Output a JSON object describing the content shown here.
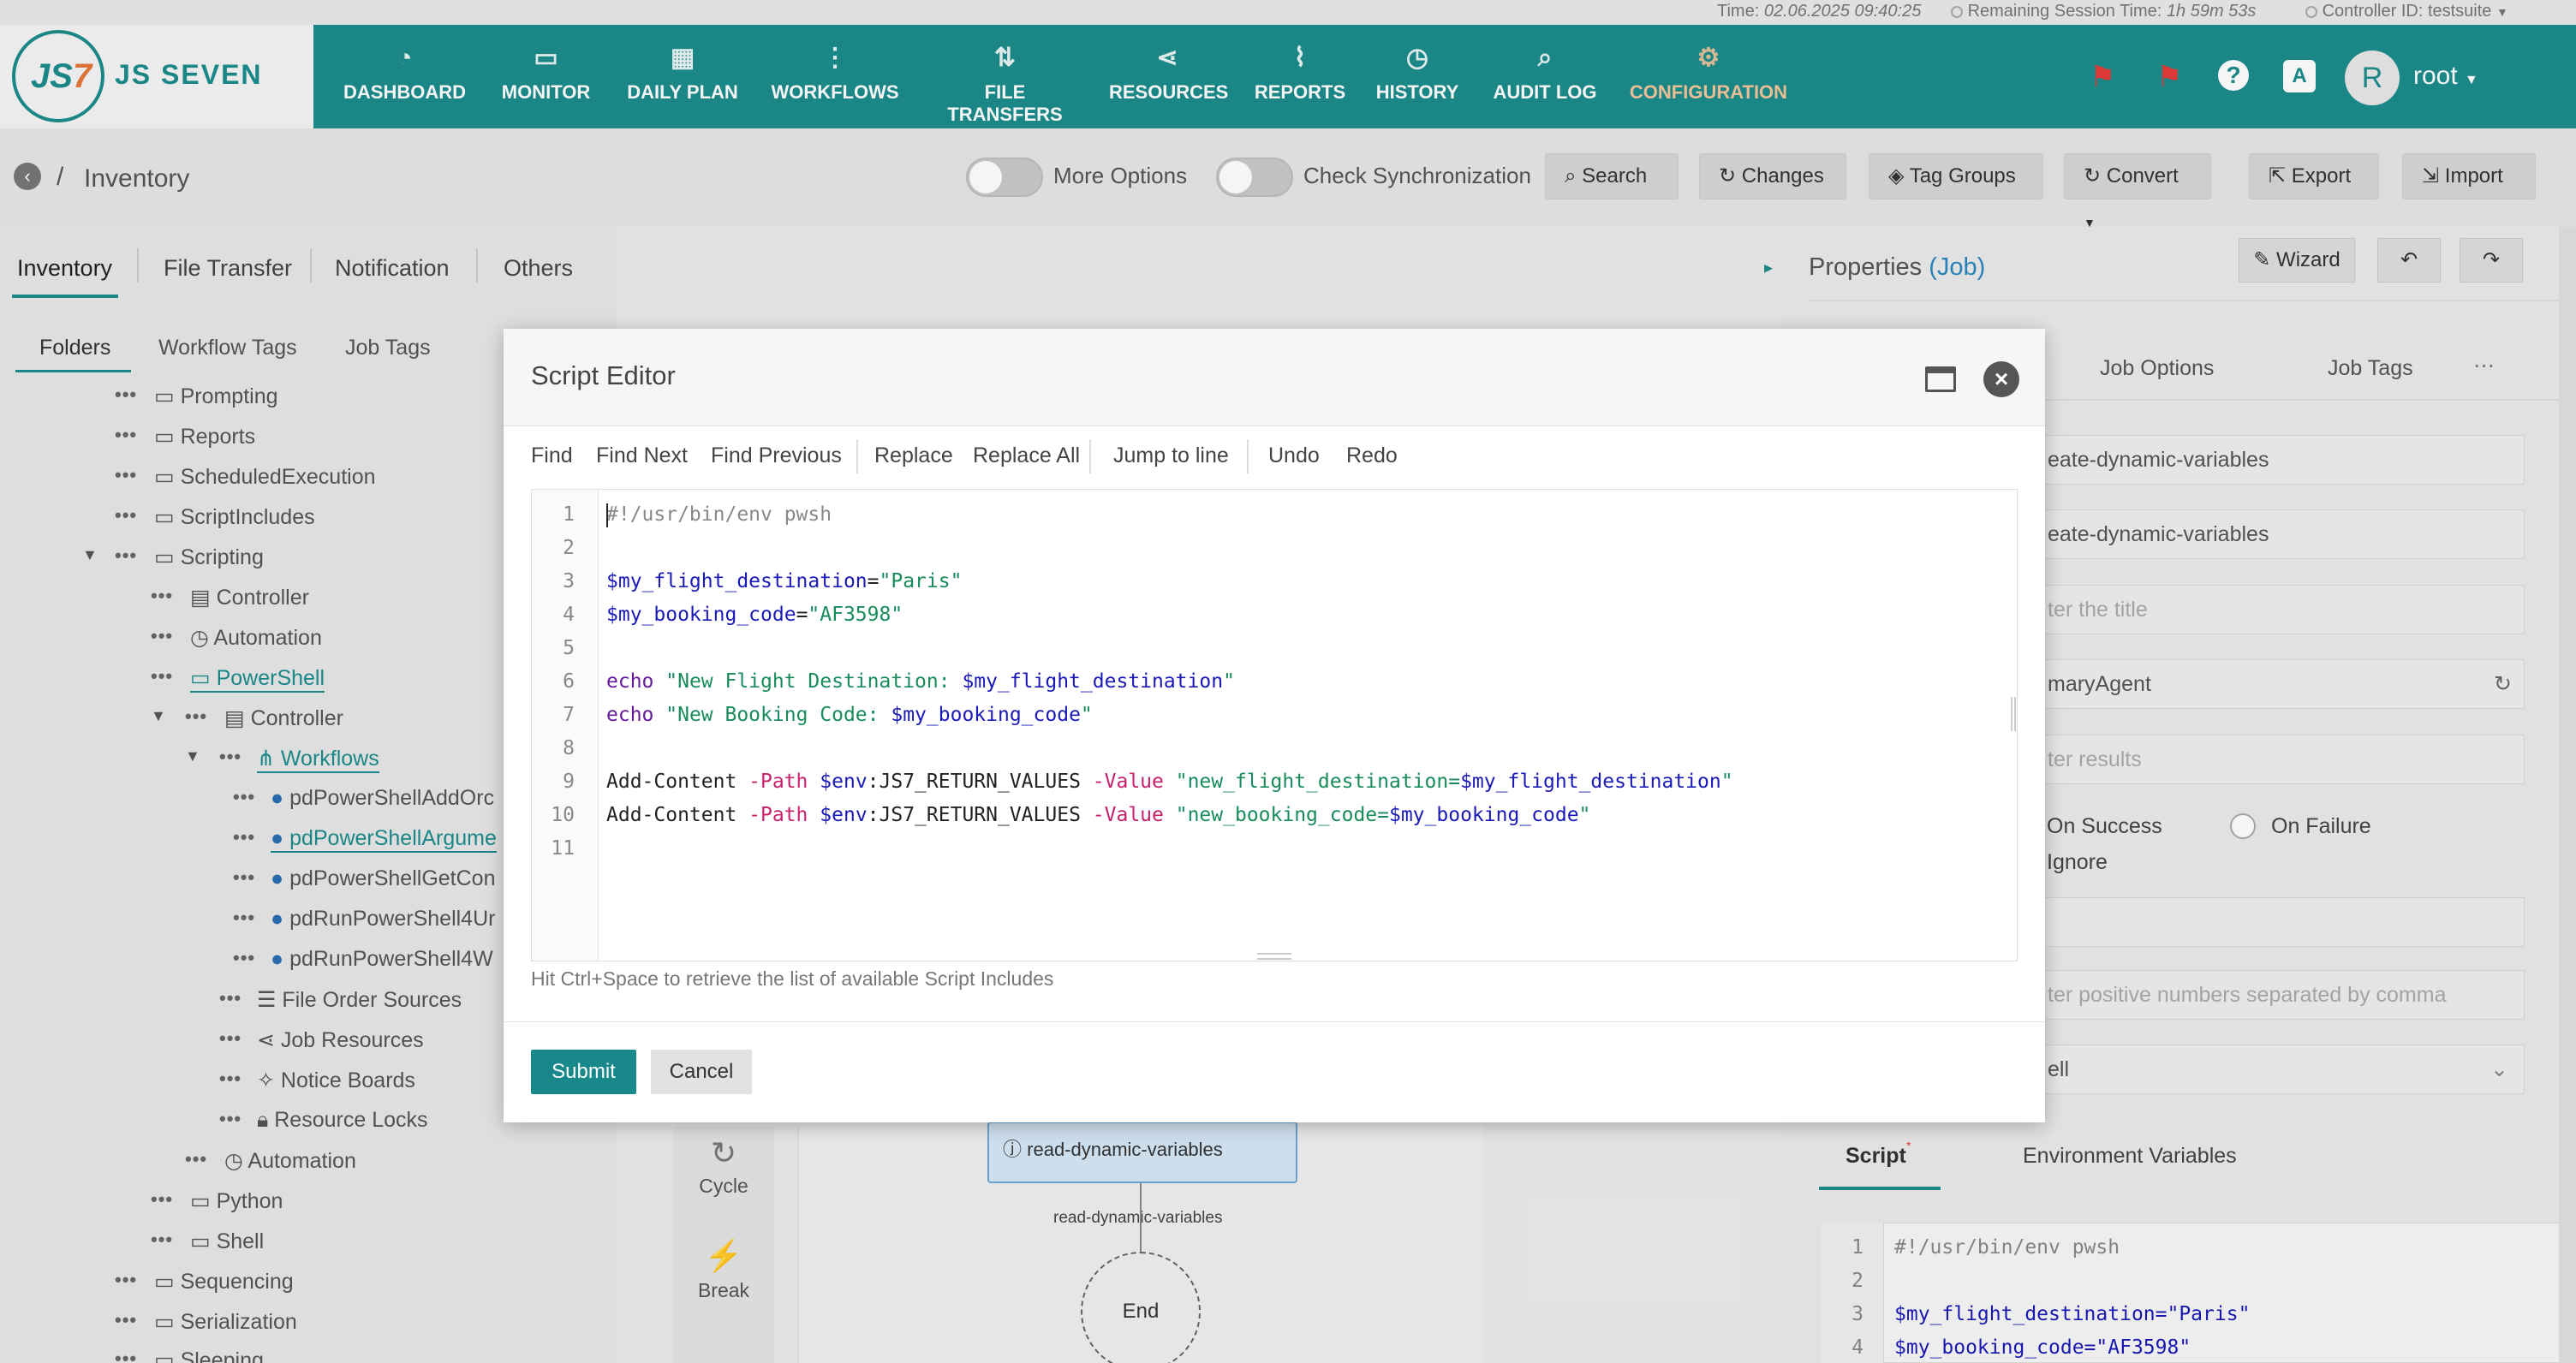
{
  "topbar": {
    "time_label": "Time:",
    "time_value": "02.06.2025 09:40:25",
    "remaining_label": "Remaining Session Time:",
    "remaining_value": "1h 59m 53s",
    "controller_label": "Controller ID:",
    "controller_value": "testsuite"
  },
  "brand": {
    "logo_text": "JS SEVEN",
    "logo_mark": "JS7"
  },
  "nav": {
    "items": [
      {
        "label": "DASHBOARD",
        "icon": "dashboard-icon",
        "glyph": "◔"
      },
      {
        "label": "MONITOR",
        "icon": "monitor-icon",
        "glyph": "▭"
      },
      {
        "label": "DAILY PLAN",
        "icon": "calendar-icon",
        "glyph": "▦"
      },
      {
        "label": "WORKFLOWS",
        "icon": "workflow-icon",
        "glyph": "⋮"
      },
      {
        "label": "FILE TRANSFERS",
        "icon": "transfer-icon",
        "glyph": "⇅"
      },
      {
        "label": "RESOURCES",
        "icon": "share-icon",
        "glyph": "⋖"
      },
      {
        "label": "REPORTS",
        "icon": "chart-icon",
        "glyph": "⌇"
      },
      {
        "label": "HISTORY",
        "icon": "clock-icon",
        "glyph": "◷"
      },
      {
        "label": "AUDIT LOG",
        "icon": "audit-icon",
        "glyph": "⌕"
      },
      {
        "label": "CONFIGURATION",
        "icon": "gear-icon",
        "glyph": "⚙"
      }
    ],
    "user_initial": "R",
    "user_name": "root"
  },
  "breadcrumb": {
    "separator": "/",
    "title": "Inventory"
  },
  "toolbar": {
    "more_options": "More Options",
    "check_sync": "Check Synchronization",
    "search": "Search",
    "changes": "Changes",
    "tag_groups": "Tag Groups",
    "convert": "Convert",
    "export": "Export",
    "import": "Import"
  },
  "left_tabs": {
    "inventory": "Inventory",
    "file_transfer": "File Transfer",
    "notification": "Notification",
    "others": "Others"
  },
  "sub_tabs": {
    "folders": "Folders",
    "workflow_tags": "Workflow Tags",
    "job_tags": "Job Tags"
  },
  "tree": [
    {
      "label": "Prompting"
    },
    {
      "label": "Reports"
    },
    {
      "label": "ScheduledExecution"
    },
    {
      "label": "ScriptIncludes"
    },
    {
      "label": "Scripting"
    },
    {
      "label": "Controller"
    },
    {
      "label": "Automation"
    },
    {
      "label": "PowerShell"
    },
    {
      "label": "Controller"
    },
    {
      "label": "Workflows"
    },
    {
      "label": "pdPowerShellAddOrc"
    },
    {
      "label": "pdPowerShellArgume"
    },
    {
      "label": "pdPowerShellGetCon"
    },
    {
      "label": "pdRunPowerShell4Ur"
    },
    {
      "label": "pdRunPowerShell4W"
    },
    {
      "label": "File Order Sources"
    },
    {
      "label": "Job Resources"
    },
    {
      "label": "Notice Boards"
    },
    {
      "label": "Resource Locks"
    },
    {
      "label": "Automation"
    },
    {
      "label": "Python"
    },
    {
      "label": "Shell"
    },
    {
      "label": "Sequencing"
    },
    {
      "label": "Serialization"
    },
    {
      "label": "Sleeping"
    }
  ],
  "properties": {
    "title": "Properties",
    "type": "(Job)",
    "wizard": "Wizard",
    "tab_job_options": "Job Options",
    "tab_job_tags": "Job Tags",
    "field1": "eate-dynamic-variables",
    "field2": "eate-dynamic-variables",
    "field3_placeholder": "ter the title",
    "field4": "maryAgent",
    "field5_placeholder": "ter results",
    "on_success": "On Success",
    "on_failure": "On Failure",
    "ignore": "Ignore",
    "field7_placeholder": "ter positive numbers separated by comma",
    "field8": "ell",
    "tab_script": "Script",
    "tab_env": "Environment Variables",
    "code_preview": [
      {
        "n": "1",
        "text": "#!/usr/bin/env pwsh"
      },
      {
        "n": "2",
        "text": ""
      },
      {
        "n": "3",
        "text": "$my_flight_destination=\"Paris\""
      },
      {
        "n": "4",
        "text": "$my_booking_code=\"AF3598\""
      }
    ]
  },
  "canvas": {
    "cycle": "Cycle",
    "break": "Break",
    "node": "read-dynamic-variables",
    "edge_label": "read-dynamic-variables",
    "end": "End"
  },
  "script_editor": {
    "title": "Script Editor",
    "toolbar": [
      "Find",
      "Find Next",
      "Find Previous",
      "Replace",
      "Replace All",
      "Jump to line",
      "Undo",
      "Redo"
    ],
    "hint": "Hit Ctrl+Space to retrieve the list of available Script Includes",
    "submit": "Submit",
    "cancel": "Cancel",
    "lines": [
      "1",
      "2",
      "3",
      "4",
      "5",
      "6",
      "7",
      "8",
      "9",
      "10",
      "11"
    ]
  }
}
